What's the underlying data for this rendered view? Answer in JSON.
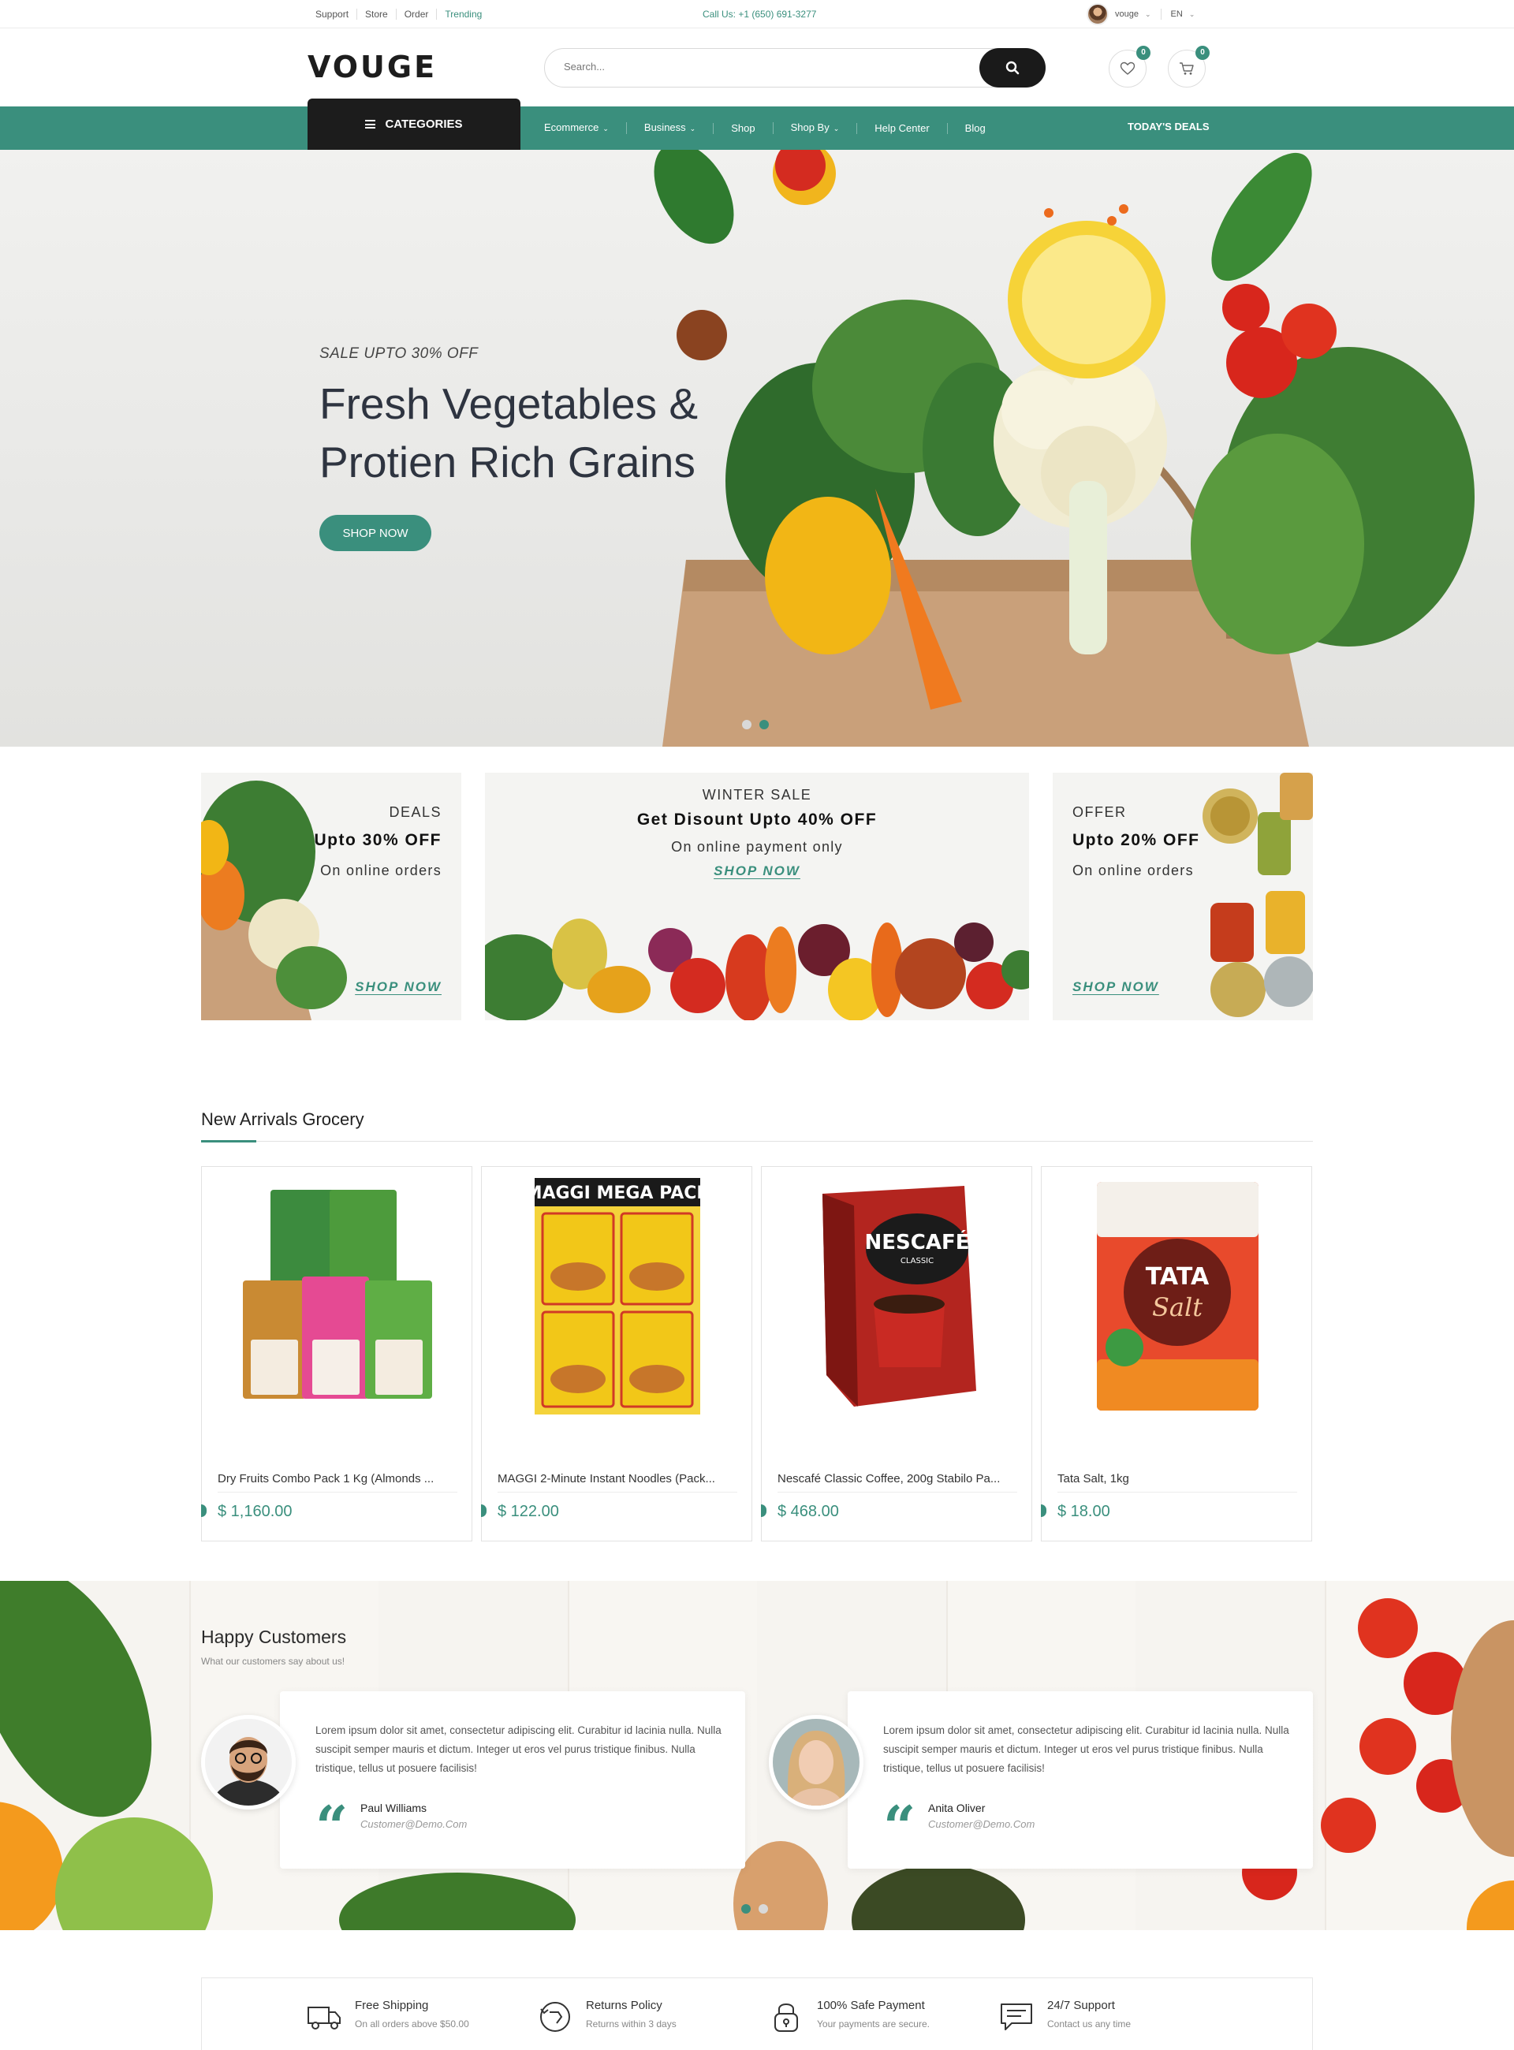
{
  "topbar": {
    "links": [
      "Support",
      "Store",
      "Order",
      "Trending"
    ],
    "call": "Call Us: +1 (650) 691-3277",
    "user": "vouge",
    "language": "EN"
  },
  "header": {
    "logo": "VOUGE",
    "search_placeholder": "Search...",
    "wishlist_count": "0",
    "cart_count": "0"
  },
  "nav": {
    "categories_label": "CATEGORIES",
    "links": [
      {
        "label": "Ecommerce",
        "dropdown": true
      },
      {
        "label": "Business",
        "dropdown": true
      },
      {
        "label": "Shop",
        "dropdown": false
      },
      {
        "label": "Shop By",
        "dropdown": true
      },
      {
        "label": "Help Center",
        "dropdown": false
      },
      {
        "label": "Blog",
        "dropdown": false
      }
    ],
    "deals_label": "TODAY'S DEALS"
  },
  "hero": {
    "subtitle": "SALE UPTO 30% OFF",
    "title_line1": "Fresh Vegetables &",
    "title_line2": "Protien Rich Grains",
    "button": "SHOP NOW"
  },
  "banners": {
    "left": {
      "label": "DEALS",
      "heading": "Upto 30% OFF",
      "sub": "On online orders",
      "cta": "SHOP NOW"
    },
    "center": {
      "label": "WINTER SALE",
      "heading": "Get Disount Upto 40% OFF",
      "sub": "On online payment only",
      "cta": "SHOP NOW"
    },
    "right": {
      "label": "OFFER",
      "heading": "Upto 20% OFF",
      "sub": "On online orders",
      "cta": "SHOP NOW"
    }
  },
  "arrivals": {
    "title": "New Arrivals Grocery",
    "products": [
      {
        "name": "Dry Fruits Combo Pack 1 Kg (Almonds ...",
        "price": "$ 1,160.00"
      },
      {
        "name": "MAGGI 2-Minute Instant Noodles (Pack...",
        "price": "$ 122.00"
      },
      {
        "name": "Nescafé Classic Coffee, 200g Stabilo Pa...",
        "price": "$ 468.00"
      },
      {
        "name": "Tata Salt, 1kg",
        "price": "$ 18.00"
      }
    ],
    "pack_labels": {
      "maggi_banner": "MAGGI MEGA PACK",
      "nescafe_brand": "NESCAFÉ",
      "nescafe_sub": "CLASSIC",
      "tata_brand": "TATA",
      "tata_product": "Salt"
    }
  },
  "testimonials": {
    "title": "Happy Customers",
    "subtitle": "What our customers say about us!",
    "items": [
      {
        "text": "Lorem ipsum dolor sit amet, consectetur adipiscing elit. Curabitur id lacinia nulla. Nulla suscipit semper mauris et dictum. Integer ut eros vel purus tristique finibus. Nulla tristique, tellus ut posuere facilisis!",
        "name": "Paul Williams",
        "email": "Customer@Demo.Com"
      },
      {
        "text": "Lorem ipsum dolor sit amet, consectetur adipiscing elit. Curabitur id lacinia nulla. Nulla suscipit semper mauris et dictum. Integer ut eros vel purus tristique finibus. Nulla tristique, tellus ut posuere facilisis!",
        "name": "Anita Oliver",
        "email": "Customer@Demo.Com"
      }
    ]
  },
  "features": [
    {
      "title": "Free Shipping",
      "sub": "On all orders above $50.00",
      "icon": "truck-icon"
    },
    {
      "title": "Returns Policy",
      "sub": "Returns within 3 days",
      "icon": "return-icon"
    },
    {
      "title": "100% Safe Payment",
      "sub": "Your payments are secure.",
      "icon": "lock-icon"
    },
    {
      "title": "24/7 Support",
      "sub": "Contact us any time",
      "icon": "chat-icon"
    }
  ],
  "colors": {
    "accent": "#3a8f7d",
    "dark": "#1c1c1c"
  }
}
